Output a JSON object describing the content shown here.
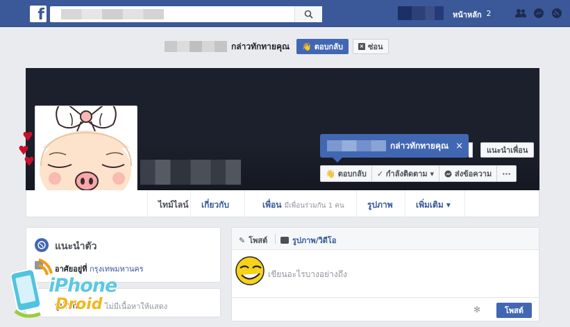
{
  "topbar": {
    "logo": "f",
    "home_label": "หน้าหลัก",
    "home_count": "2"
  },
  "greeting": {
    "text": "กล่าวทักทายคุณ",
    "reply_label": "ตอบกลับ",
    "hide_label": "ซ่อน"
  },
  "cover": {
    "tooltip_text": "กล่าวทักทายคุณ",
    "tooltip_close": "×",
    "suggest_friend": "แนะนำเพื่อน",
    "actions": {
      "reply": "ตอบกลับ",
      "following": "✓ กำลังติดตาม ▾",
      "message": "ส่งข้อความ",
      "more": "···"
    }
  },
  "tabs": {
    "timeline": "ไทม์ไลน์",
    "about": "เกี่ยวกับ",
    "friends": "เพื่อน",
    "friends_sub": "มีเพื่อนร่วมกัน 1 คน",
    "photos": "รูปภาพ",
    "more": "เพิ่มเติม ▾"
  },
  "intro": {
    "title": "แนะนำตัว",
    "lives_prefix": "อาศัยอยู่ที่",
    "lives_place": "กรุงเทพมหานคร"
  },
  "photos_box": {
    "title": "รูปภาพ",
    "empty": "ไม่มีเนื้อหาให้แสดง"
  },
  "composer": {
    "tab_post": "โพสต์",
    "tab_photo": "รูปภาพ/วิดีโอ",
    "placeholder": "เขียนอะไรบางอย่างถึง",
    "post_button": "โพสต์"
  },
  "watermark": {
    "line1": "iPhone",
    "line2": "Droid"
  }
}
